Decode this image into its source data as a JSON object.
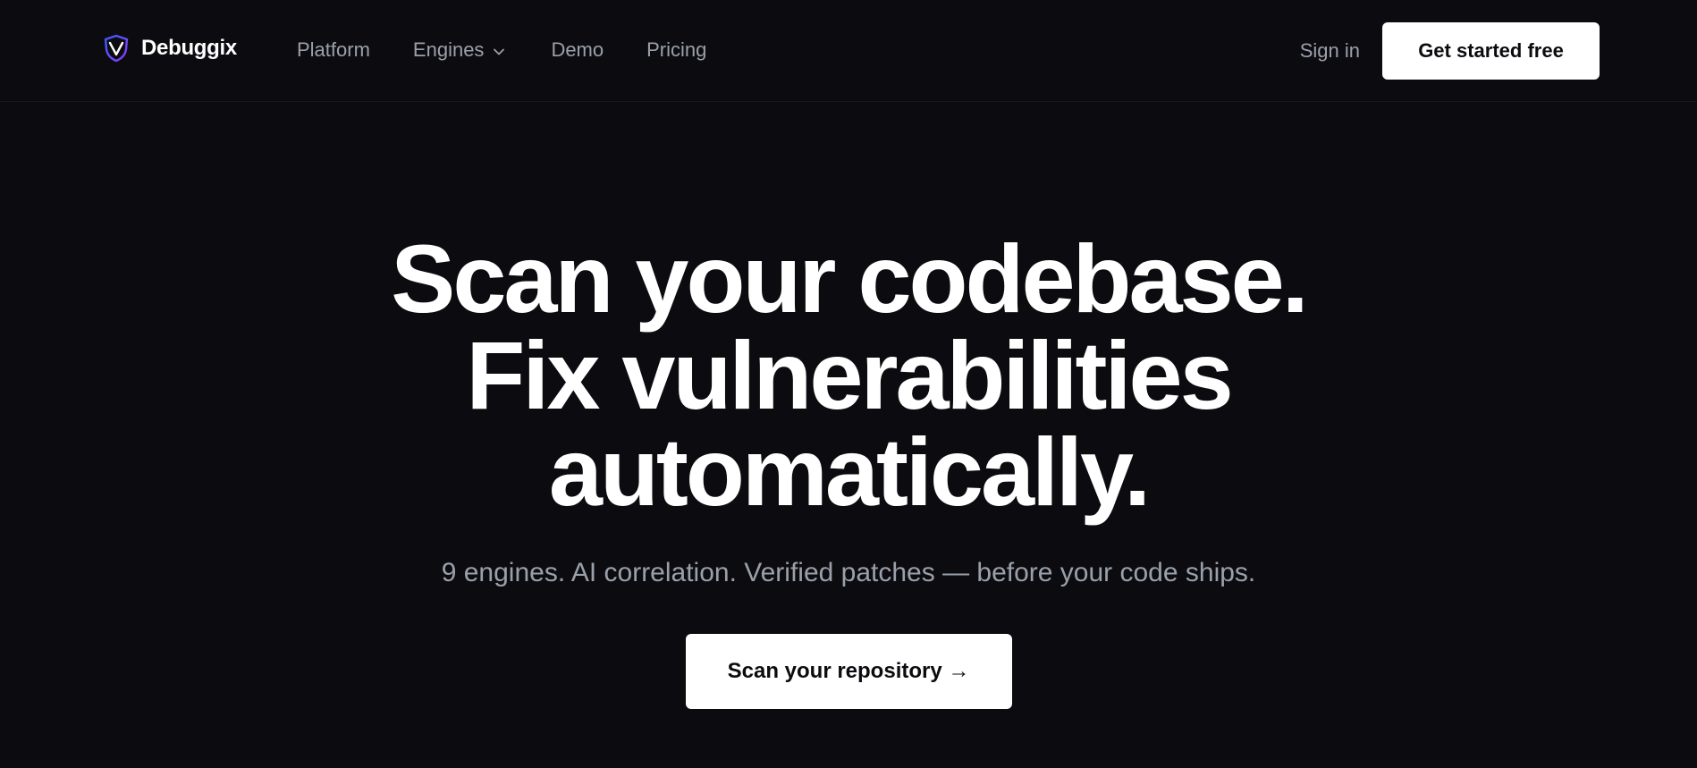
{
  "brand": {
    "name": "Debuggix",
    "logo_icon": "shield-v-logo-icon",
    "logo_colors": [
      "#3b5bff",
      "#8b3dff"
    ]
  },
  "nav": {
    "items": [
      {
        "label": "Platform"
      },
      {
        "label": "Engines",
        "icon": "chevron-down-icon"
      },
      {
        "label": "Demo"
      },
      {
        "label": "Pricing"
      }
    ],
    "signin_label": "Sign in",
    "cta_label": "Get started free"
  },
  "hero": {
    "headline_line1": "Scan your codebase.",
    "headline_line2": "Fix vulnerabilities",
    "headline_line3": "automatically.",
    "subhead": "9 engines. AI correlation. Verified patches — before your code ships.",
    "cta_label": "Scan your repository →"
  },
  "colors": {
    "background": "#0c0c10",
    "text": "#ffffff",
    "muted": "#9aa0ab",
    "button_bg": "#ffffff",
    "button_text": "#0c0c10"
  }
}
